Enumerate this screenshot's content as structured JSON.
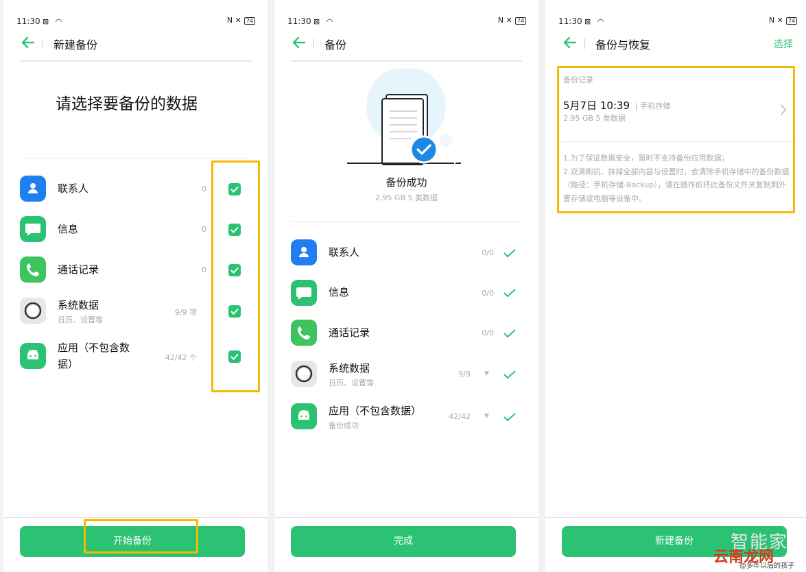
{
  "status": {
    "time": "11:30",
    "battery": "74"
  },
  "colors": {
    "accent": "#2bc274",
    "highlight": "#f6b800"
  },
  "screen1": {
    "title": "新建备份",
    "heading": "请选择要备份的数据",
    "items": [
      {
        "name": "联系人",
        "sub": "",
        "count": "0",
        "icon": "contacts-icon",
        "checked": true
      },
      {
        "name": "信息",
        "sub": "",
        "count": "0",
        "icon": "message-icon",
        "checked": true
      },
      {
        "name": "通话记录",
        "sub": "",
        "count": "0",
        "icon": "phone-icon",
        "checked": true
      },
      {
        "name": "系统数据",
        "sub": "日历、设置等",
        "count": "9/9 项",
        "icon": "system-icon",
        "checked": true
      },
      {
        "name": "应用（不包含数",
        "name2": "据）",
        "sub": "",
        "count": "42/42 个",
        "icon": "android-icon",
        "checked": true
      }
    ],
    "button": "开始备份"
  },
  "screen2": {
    "title": "备份",
    "success": "备份成功",
    "summary": "2.95 GB  5 类数据",
    "items": [
      {
        "name": "联系人",
        "sub": "",
        "count": "0/0",
        "icon": "contacts-icon"
      },
      {
        "name": "信息",
        "sub": "",
        "count": "0/0",
        "icon": "message-icon"
      },
      {
        "name": "通话记录",
        "sub": "",
        "count": "0/0",
        "icon": "phone-icon"
      },
      {
        "name": "系统数据",
        "sub": "日历、设置等",
        "count": "9/9",
        "icon": "system-icon"
      },
      {
        "name": "应用（不包含数据）",
        "sub": "备份成功",
        "count": "42/42",
        "icon": "android-icon"
      }
    ],
    "button": "完成"
  },
  "screen3": {
    "title": "备份与恢复",
    "action": "选择",
    "section_label": "备份记录",
    "record": {
      "date": "5月7日 10:39",
      "location": "| 手机存储",
      "size": "2.95 GB  5 类数据"
    },
    "note1": "1.为了保证数据安全，暂时不支持备份应用数据；",
    "note2": "2.双清刷机、抹掉全部内容与设置时，会清除手机存储中的备份数据（路径：手机存储-Backup），请在操作前将此备份文件夹复制到外置存储或电脑等设备中。",
    "button": "新建备份"
  },
  "watermark": {
    "brand1": "智能家",
    "brand2": "云南龙网",
    "credit": "@多年以后的孩子"
  }
}
